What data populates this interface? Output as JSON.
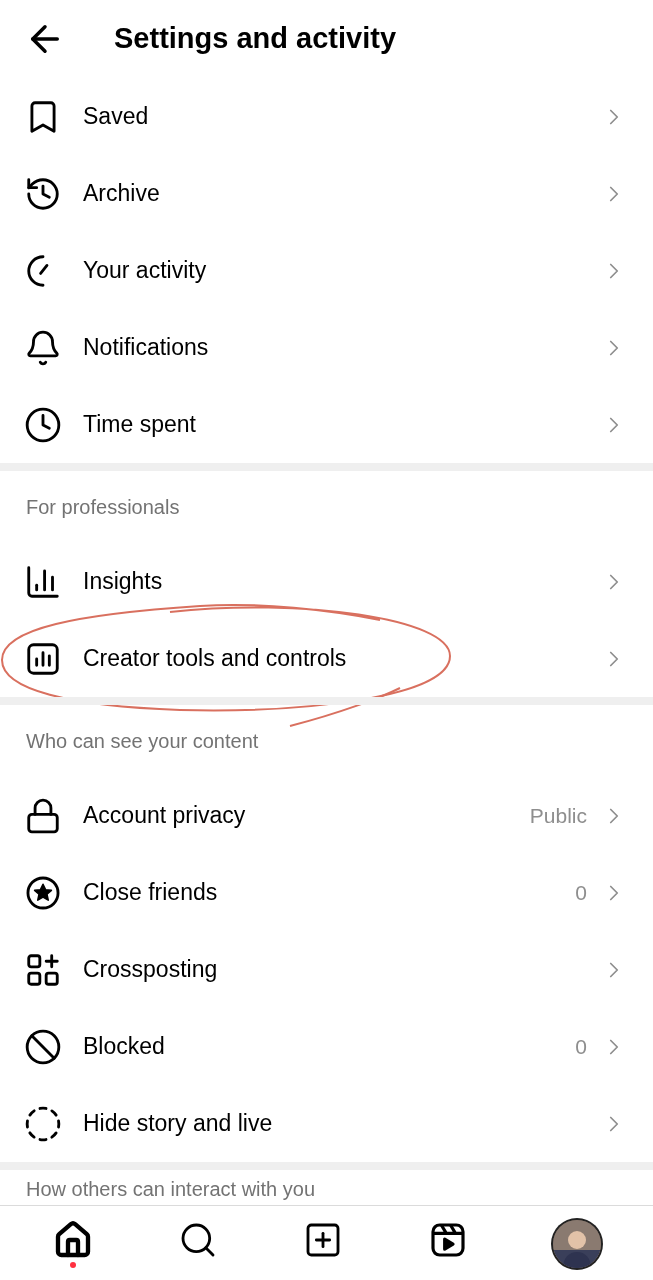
{
  "header": {
    "title": "Settings and activity"
  },
  "sections": [
    {
      "items": [
        {
          "label": "Saved"
        },
        {
          "label": "Archive"
        },
        {
          "label": "Your activity"
        },
        {
          "label": "Notifications"
        },
        {
          "label": "Time spent"
        }
      ]
    },
    {
      "heading": "For professionals",
      "items": [
        {
          "label": "Insights"
        },
        {
          "label": "Creator tools and controls"
        }
      ]
    },
    {
      "heading": "Who can see your content",
      "items": [
        {
          "label": "Account privacy",
          "value": "Public"
        },
        {
          "label": "Close friends",
          "value": "0"
        },
        {
          "label": "Crossposting"
        },
        {
          "label": "Blocked",
          "value": "0"
        },
        {
          "label": "Hide story and live"
        }
      ]
    },
    {
      "heading": "How others can interact with you"
    }
  ],
  "nav": [
    {
      "selected": true
    },
    {
      "selected": false
    },
    {
      "selected": false
    },
    {
      "selected": false
    },
    {
      "selected": false
    }
  ]
}
